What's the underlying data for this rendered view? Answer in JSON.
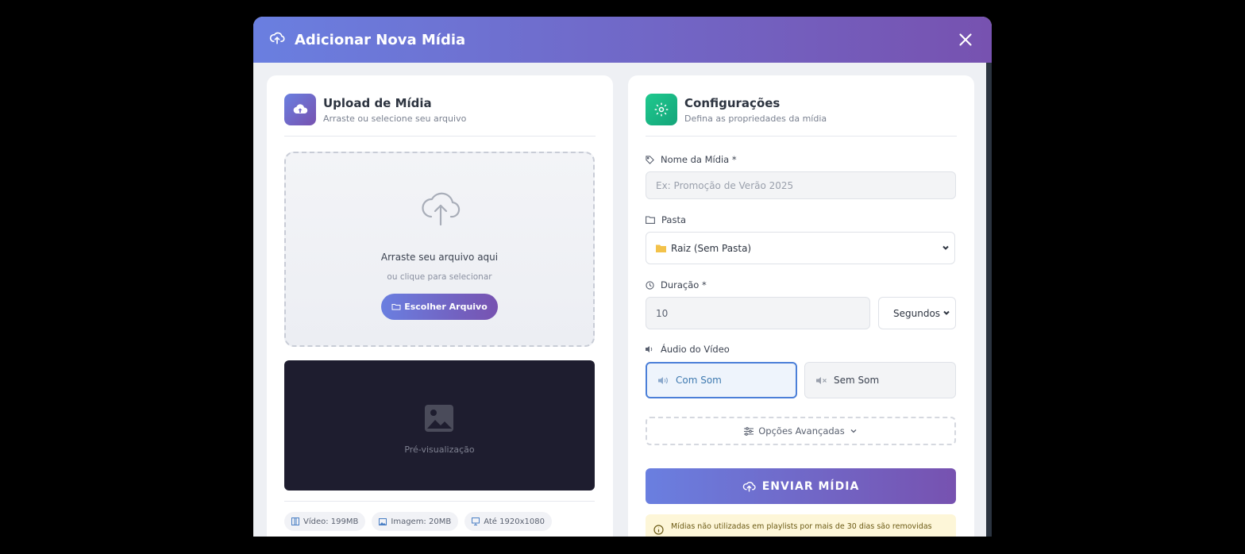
{
  "modal": {
    "title": "Adicionar Nova Mídia"
  },
  "upload": {
    "title": "Upload de Mídia",
    "subtitle": "Arraste ou selecione seu arquivo",
    "drop_main": "Arraste seu arquivo aqui",
    "drop_sub": "ou clique para selecionar",
    "choose_button": "Escolher Arquivo",
    "preview_label": "Pré-visualização",
    "tags": [
      {
        "icon": "film-icon",
        "label": "Vídeo: 199MB"
      },
      {
        "icon": "image-icon",
        "label": "Imagem: 20MB"
      },
      {
        "icon": "monitor-icon",
        "label": "Até 1920x1080"
      }
    ]
  },
  "config": {
    "title": "Configurações",
    "subtitle": "Defina as propriedades da mídia",
    "name_label": "Nome da Mídia *",
    "name_placeholder": "Ex: Promoção de Verão 2025",
    "folder_label": "Pasta",
    "folder_value": "Raiz (Sem Pasta)",
    "duration_label": "Duração *",
    "duration_value": "10",
    "duration_unit": "Segundos",
    "audio_label": "Áudio do Vídeo",
    "audio_on": "Com Som",
    "audio_off": "Sem Som",
    "advanced": "Opções Avançadas",
    "send_button": "ENVIAR MÍDIA",
    "notice": "Mídias não utilizadas em playlists por mais de 30 dias são removidas"
  },
  "colors": {
    "accent_start": "#6a7fe0",
    "accent_end": "#7752b0",
    "green": "#1fc98e",
    "preview_bg": "#1e1d2f",
    "notice_bg": "#fdf6d8"
  }
}
